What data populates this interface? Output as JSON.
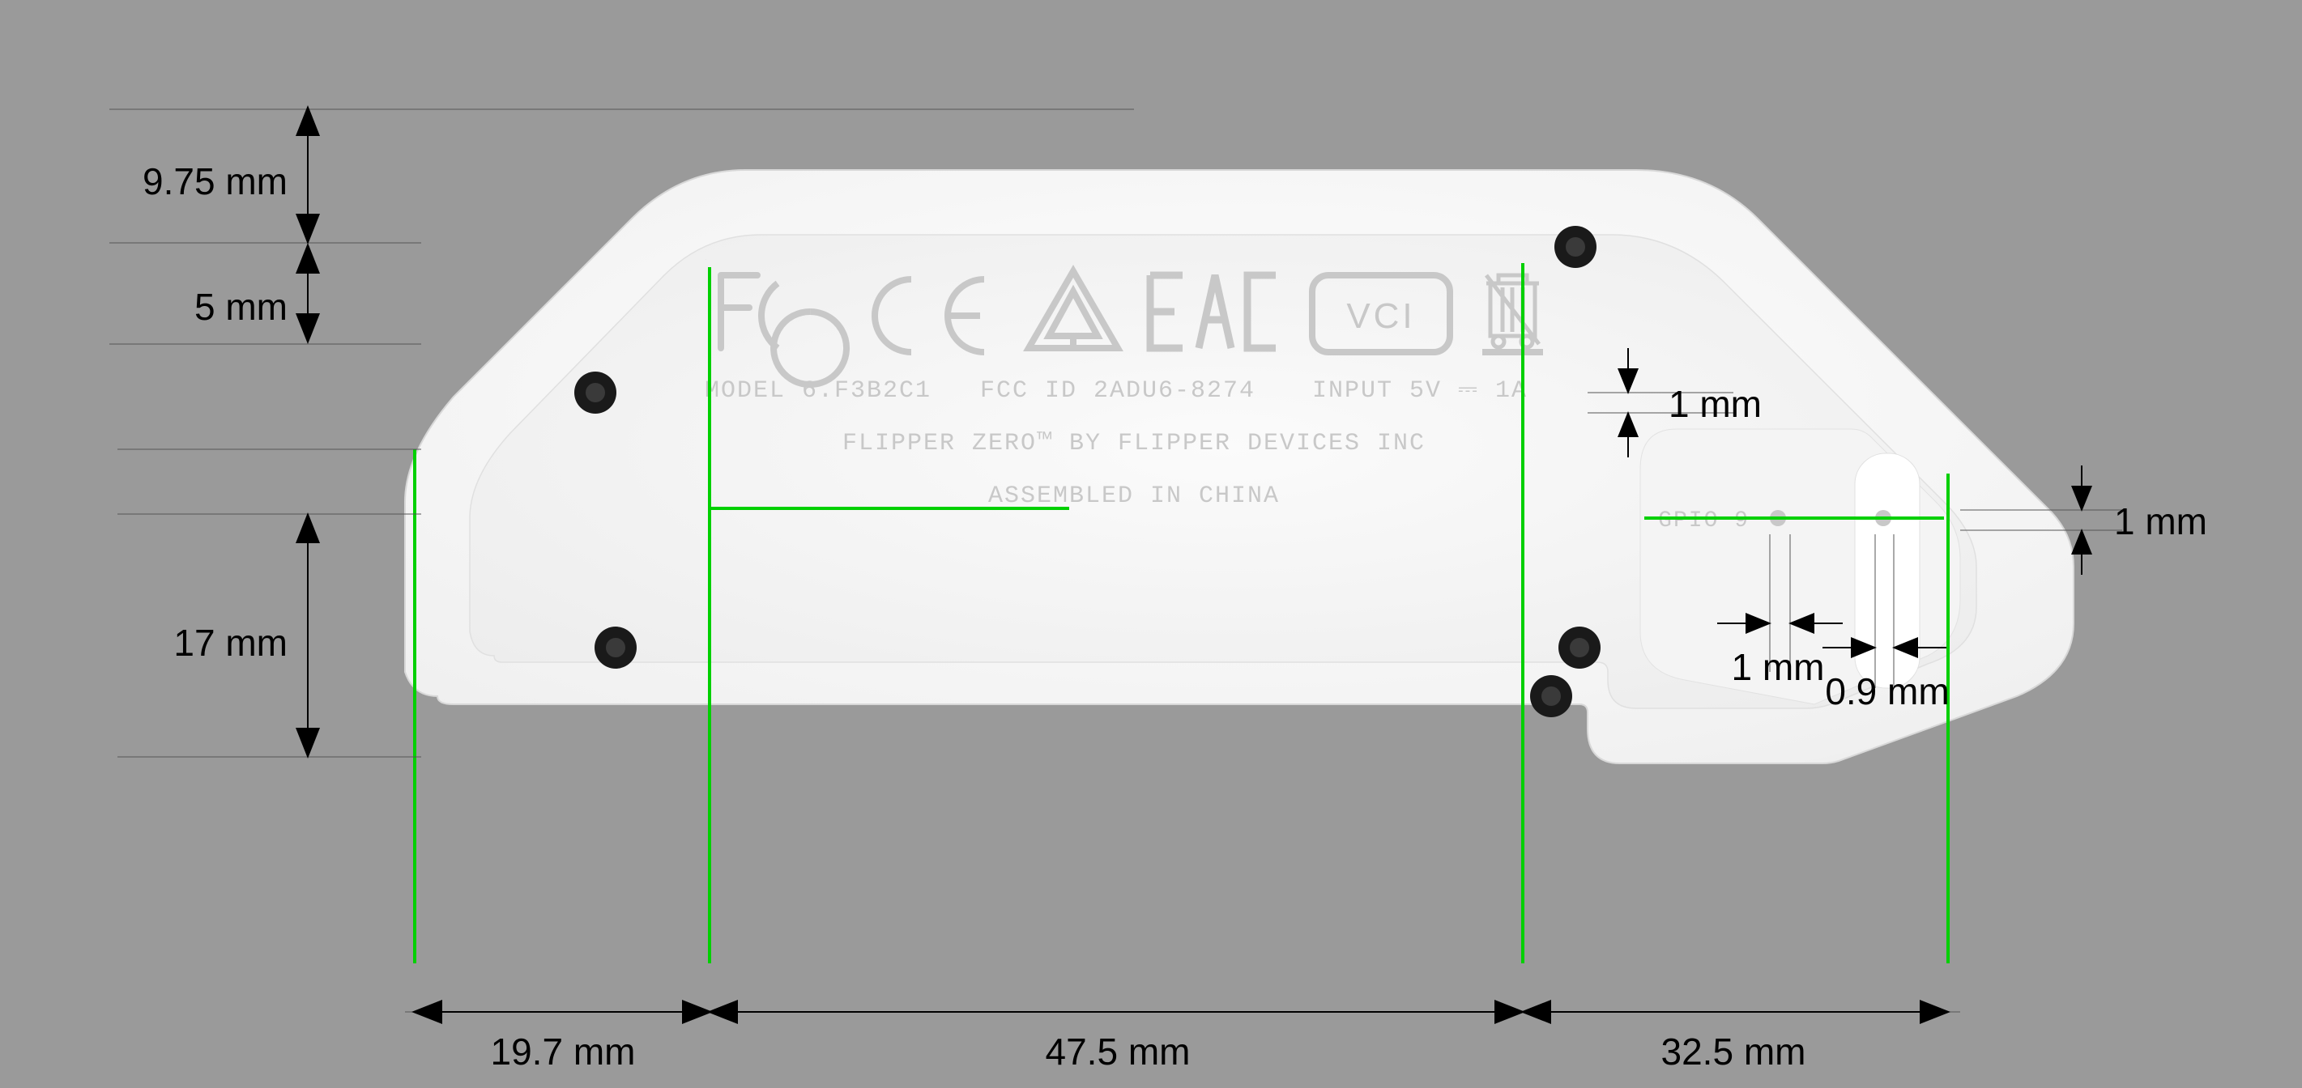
{
  "device": {
    "certifications": [
      "FCC",
      "CE",
      "RCM",
      "EAC",
      "VCCI",
      "WEEE"
    ],
    "model": "MODEL 6.F3B2C1",
    "fcc_id": "FCC ID 2ADU6-8274",
    "input": "INPUT 5V ⎓ 1A",
    "brand_line": "FLIPPER ZERO™ BY FLIPPER DEVICES INC",
    "assembly": "ASSEMBLED IN CHINA",
    "gpio_label": "GPIO 9"
  },
  "dimensions": {
    "top_offset": "9.75 mm",
    "top_margin": "5 mm",
    "left_height": "17 mm",
    "bottom_a": "19.7 mm",
    "bottom_b": "47.5 mm",
    "bottom_c": "32.5 mm",
    "ir_top": "1 mm",
    "ir_right": "1 mm",
    "pin_a": "1 mm",
    "pin_b": "0.9 mm"
  }
}
